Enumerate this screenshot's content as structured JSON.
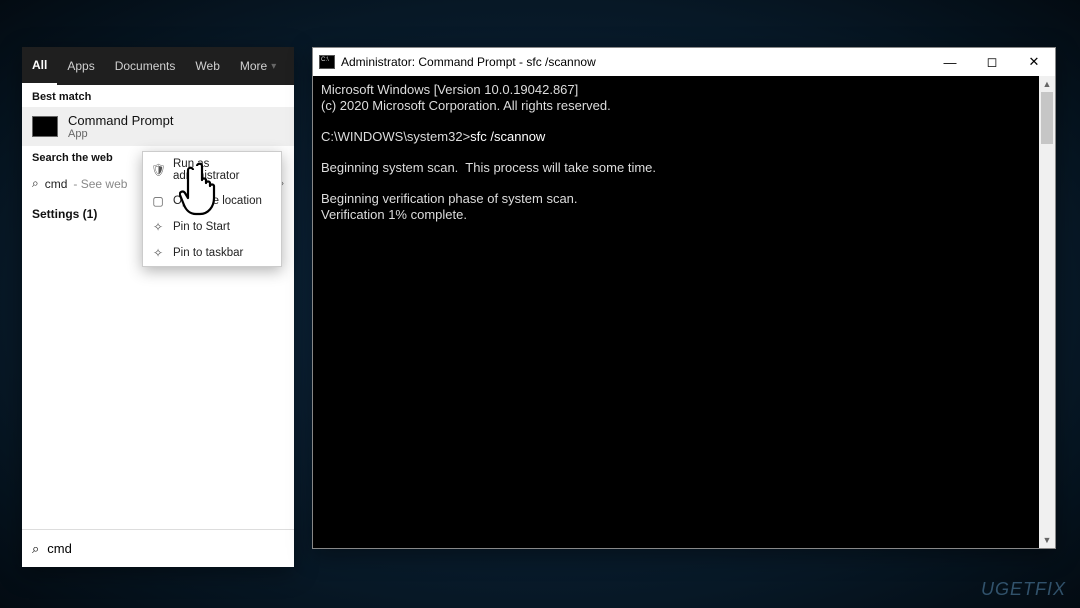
{
  "search": {
    "tabs": {
      "all": "All",
      "apps": "Apps",
      "documents": "Documents",
      "web": "Web",
      "more": "More"
    },
    "best_match_header": "Best match",
    "best_match": {
      "title": "Command Prompt",
      "subtitle": "App"
    },
    "web_header": "Search the web",
    "web_query": "cmd",
    "web_suffix": " - See web",
    "settings_label": "Settings (1)",
    "context_menu": {
      "run_admin": "Run as administrator",
      "open_location": "Open file location",
      "pin_start": "Pin to Start",
      "pin_taskbar": "Pin to taskbar"
    },
    "input_value": "cmd"
  },
  "cmd": {
    "title": "Administrator: Command Prompt - sfc  /scannow",
    "line1": "Microsoft Windows [Version 10.0.19042.867]",
    "line2": "(c) 2020 Microsoft Corporation. All rights reserved.",
    "prompt_prefix": "C:\\WINDOWS\\system32>",
    "command": "sfc /scannow",
    "out1": "Beginning system scan.  This process will take some time.",
    "out2": "Beginning verification phase of system scan.",
    "out3": "Verification 1% complete."
  },
  "watermark": "UGETFIX"
}
